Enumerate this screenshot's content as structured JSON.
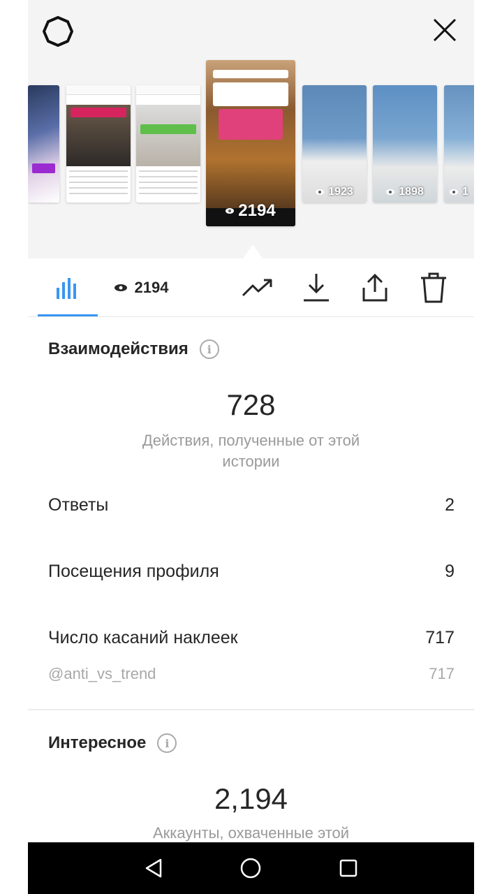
{
  "stories": {
    "thumbnails": [
      {
        "views": ""
      },
      {
        "views": ""
      },
      {
        "views": ""
      },
      {
        "views": "2194",
        "selected": true
      },
      {
        "views": "1923"
      },
      {
        "views": "1898"
      },
      {
        "views": "1"
      }
    ]
  },
  "toolbar": {
    "views": "2194"
  },
  "interactions": {
    "title": "Взаимодействия",
    "total": "728",
    "caption": "Действия, полученные от этой истории",
    "rows": [
      {
        "label": "Ответы",
        "value": "2"
      },
      {
        "label": "Посещения профиля",
        "value": "9"
      },
      {
        "label": "Число касаний наклеек",
        "value": "717"
      }
    ],
    "sub_row": {
      "label": "@anti_vs_trend",
      "value": "717"
    }
  },
  "discovery": {
    "title": "Интересное",
    "total": "2,194",
    "caption": "Аккаунты, охваченные этой"
  },
  "colors": {
    "accent": "#3897f0",
    "text": "#262626",
    "muted": "#9a9a9a"
  },
  "icons": [
    "settings-icon",
    "close-icon",
    "bar-chart-icon",
    "eye-icon",
    "trend-icon",
    "download-icon",
    "share-icon",
    "trash-icon",
    "back-icon",
    "home-icon",
    "recents-icon"
  ]
}
